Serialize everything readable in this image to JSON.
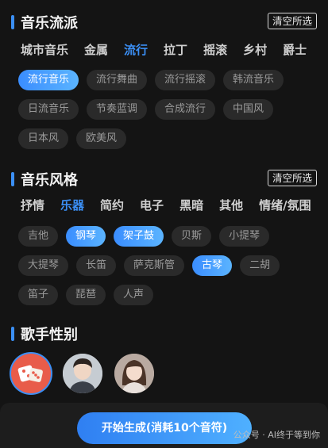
{
  "genre": {
    "title": "音乐流派",
    "clear_label": "清空所选",
    "tabs": [
      "城市音乐",
      "金属",
      "流行",
      "拉丁",
      "摇滚",
      "乡村",
      "爵士"
    ],
    "active_tab": "流行",
    "chips": [
      "流行音乐",
      "流行舞曲",
      "流行摇滚",
      "韩流音乐",
      "日流音乐",
      "节奏蓝调",
      "合成流行",
      "中国风",
      "日本风",
      "欧美风"
    ],
    "selected_chips": [
      "流行音乐"
    ]
  },
  "style": {
    "title": "音乐风格",
    "clear_label": "清空所选",
    "tabs": [
      "抒情",
      "乐器",
      "简约",
      "电子",
      "黑暗",
      "其他",
      "情绪/氛围"
    ],
    "active_tab": "乐器",
    "chips": [
      "吉他",
      "钢琴",
      "架子鼓",
      "贝斯",
      "小提琴",
      "大提琴",
      "长笛",
      "萨克斯管",
      "古琴",
      "二胡",
      "笛子",
      "琵琶",
      "人声"
    ],
    "selected_chips": [
      "钢琴",
      "架子鼓",
      "古琴"
    ]
  },
  "gender": {
    "title": "歌手性别",
    "options": [
      {
        "icon": "dice-icon",
        "selected": true
      },
      {
        "icon": "male-avatar",
        "selected": false
      },
      {
        "icon": "female-avatar",
        "selected": false
      }
    ]
  },
  "footer": {
    "generate_label": "开始生成(消耗10个音符)",
    "watermark": "公众号 · AI终于等到你"
  },
  "colors": {
    "accent": "#3b8ff5",
    "background": "#141414",
    "chip": "#2a2a2a",
    "dice": "#e85c4a"
  }
}
